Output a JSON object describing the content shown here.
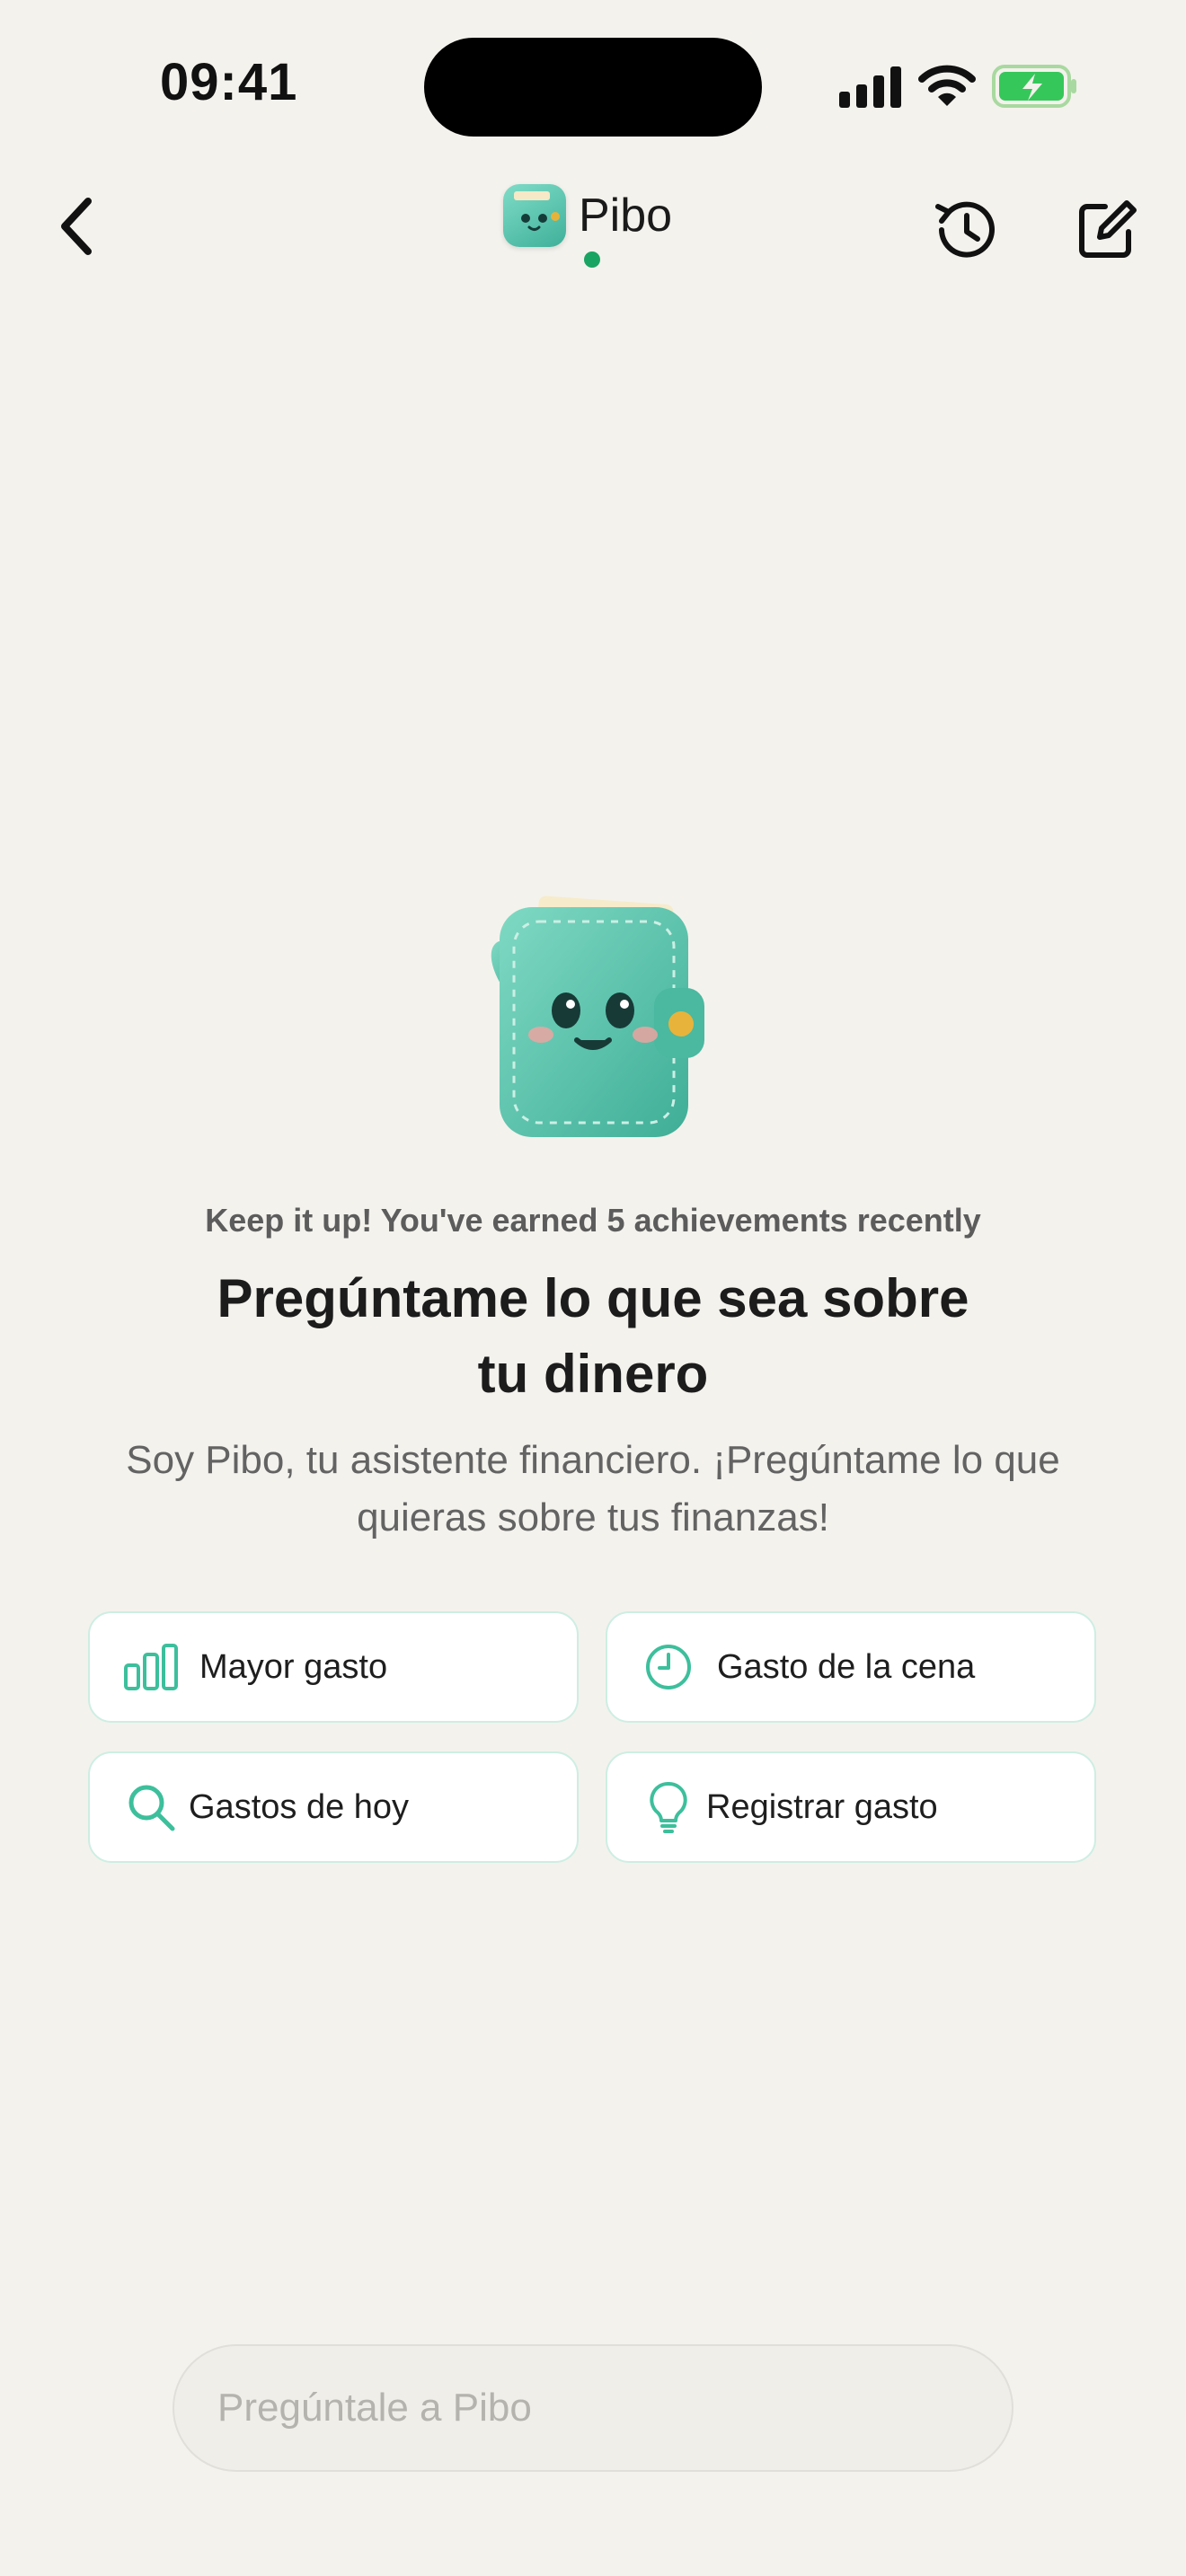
{
  "status_bar": {
    "time": "09:41"
  },
  "header": {
    "title": "Pibo",
    "online": true
  },
  "icons": {
    "back": "chevron-left-icon",
    "history": "history-icon",
    "compose": "compose-icon"
  },
  "hero": {
    "achievement": "Keep it up! You've earned 5 achievements recently",
    "headline_line1": "Pregúntame lo que sea sobre",
    "headline_line2": "tu dinero",
    "subtitle_line1": "Soy Pibo, tu asistente financiero. ¡Pregúntame lo que",
    "subtitle_line2": "quieras sobre tus finanzas!"
  },
  "suggestions": [
    {
      "label": "Mayor gasto",
      "icon": "bar-chart-icon"
    },
    {
      "label": "Gasto de la cena",
      "icon": "clock-icon"
    },
    {
      "label": "Gastos de hoy",
      "icon": "search-icon"
    },
    {
      "label": "Registrar gasto",
      "icon": "lightbulb-icon"
    }
  ],
  "composer": {
    "placeholder": "Pregúntale a Pibo"
  },
  "colors": {
    "accent": "#3dbf9c",
    "background": "#f4f2ed",
    "online": "#1aa463"
  }
}
